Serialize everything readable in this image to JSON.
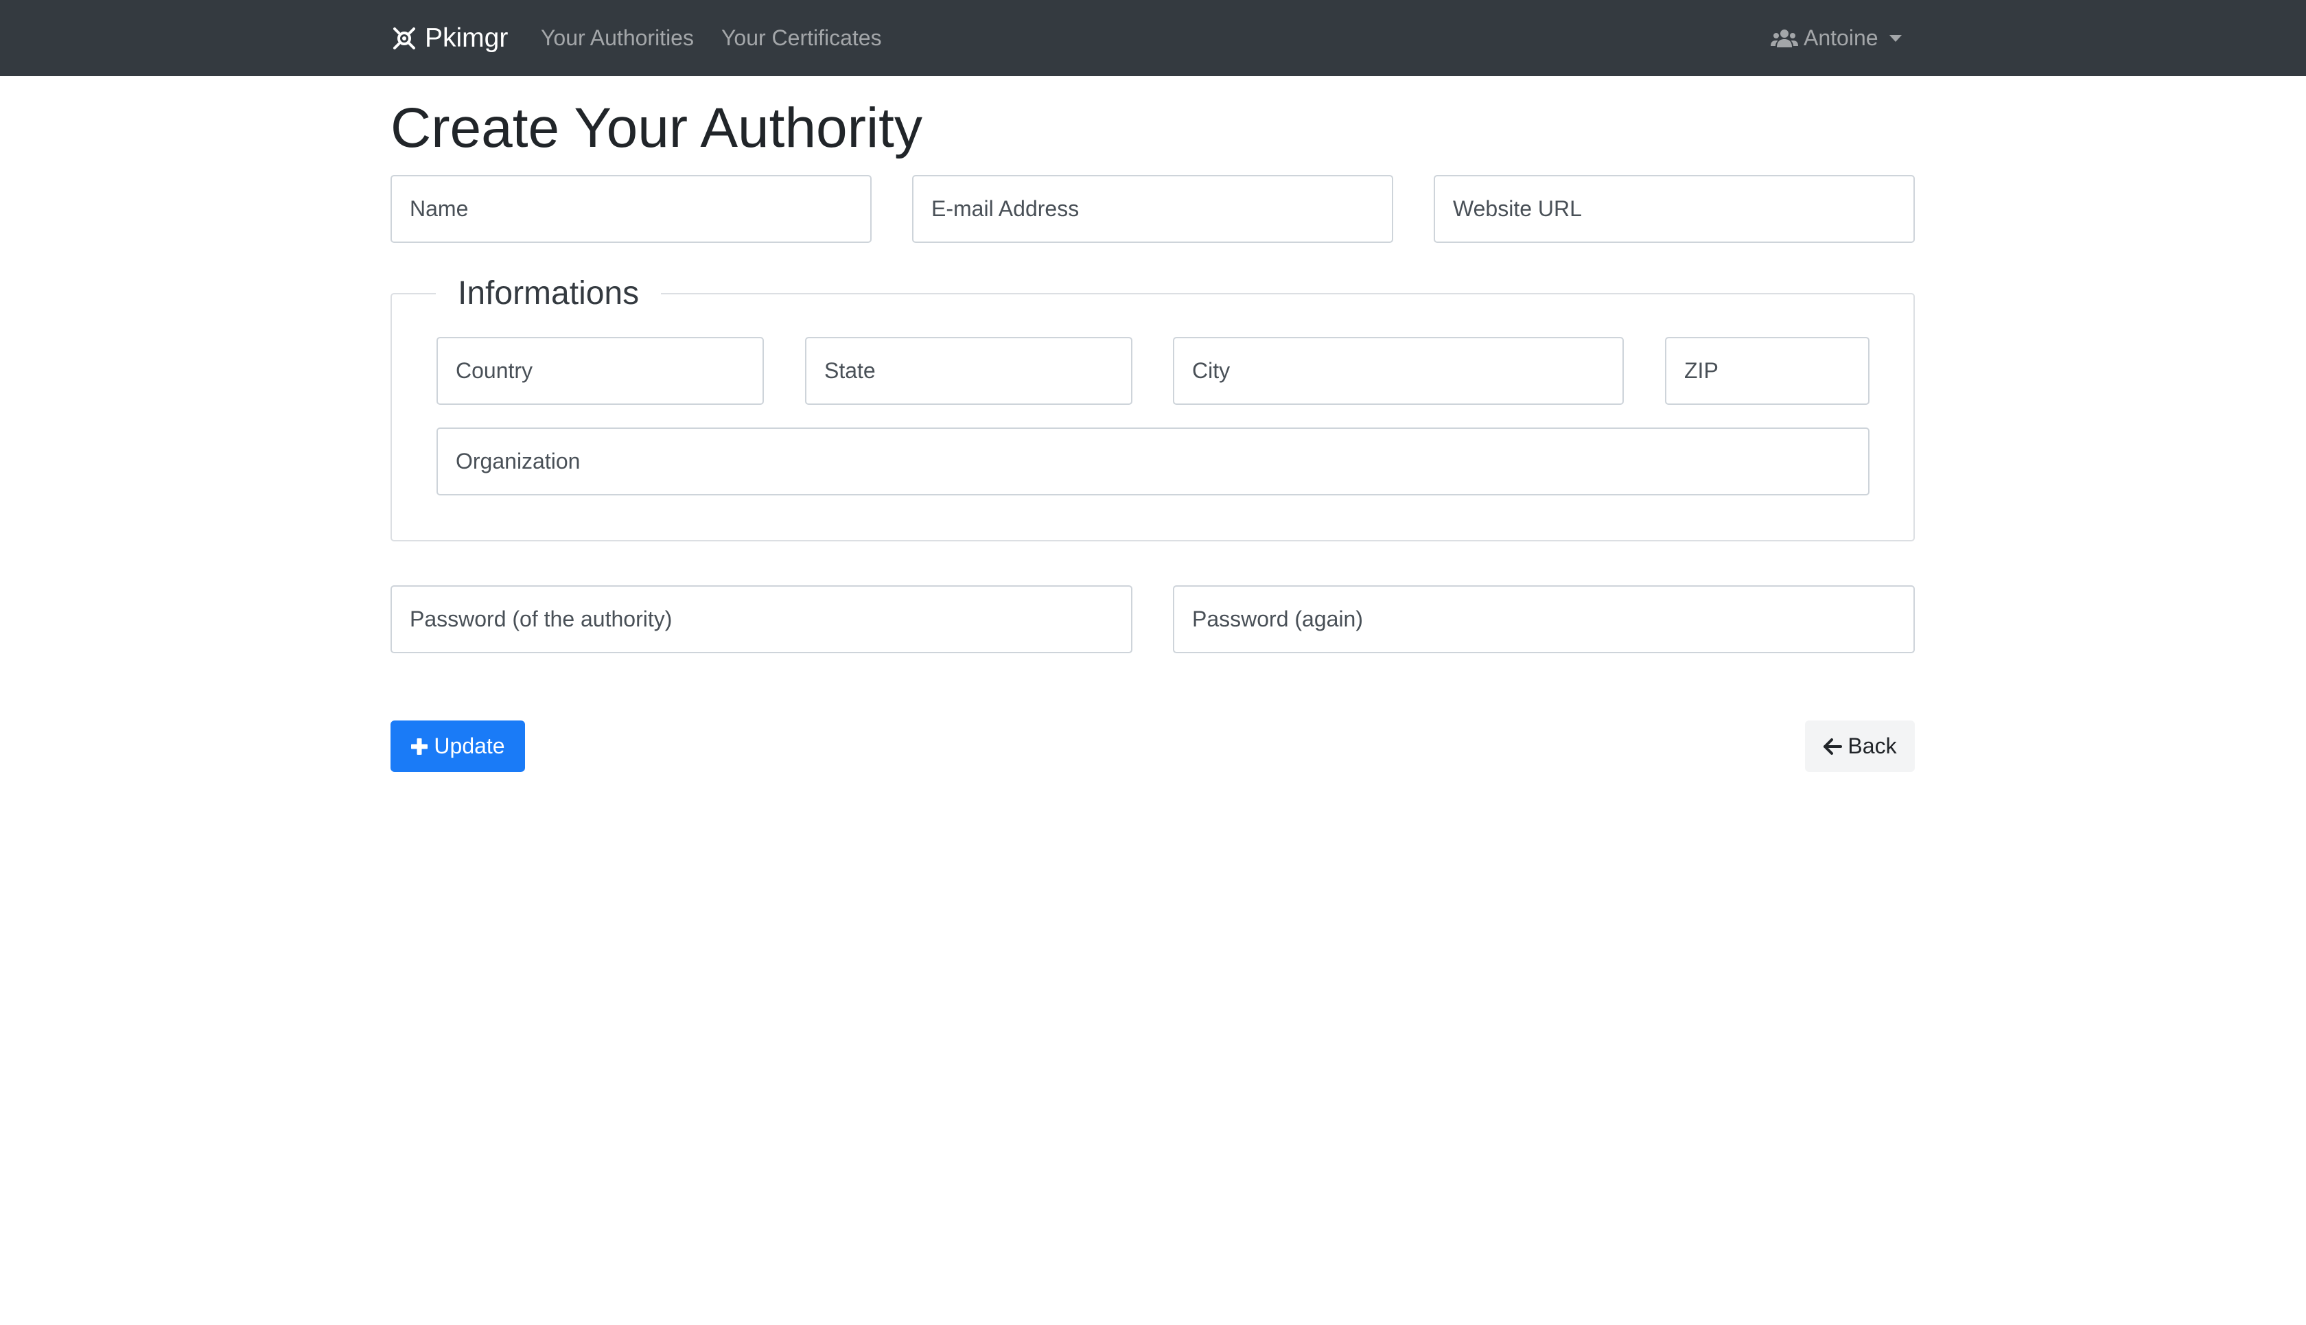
{
  "navbar": {
    "brand": "Pkimgr",
    "brand_icon": "satellite-icon",
    "links": [
      "Your Authorities",
      "Your Certificates"
    ],
    "user": "Antoine",
    "user_icon": "users-icon",
    "background": "#343a40"
  },
  "page": {
    "title": "Create Your Authority"
  },
  "form": {
    "name_placeholder": "Name",
    "email_placeholder": "E-mail Address",
    "website_placeholder": "Website URL",
    "info_legend": "Informations",
    "country_placeholder": "Country",
    "state_placeholder": "State",
    "city_placeholder": "City",
    "zip_placeholder": "ZIP",
    "organization_placeholder": "Organization",
    "password_placeholder": "Password (of the authority)",
    "password_again_placeholder": "Password (again)"
  },
  "actions": {
    "update_label": "Update",
    "update_icon": "plus-icon",
    "back_label": "Back",
    "back_icon": "arrow-left-icon",
    "primary_color": "#1a7bf7"
  }
}
